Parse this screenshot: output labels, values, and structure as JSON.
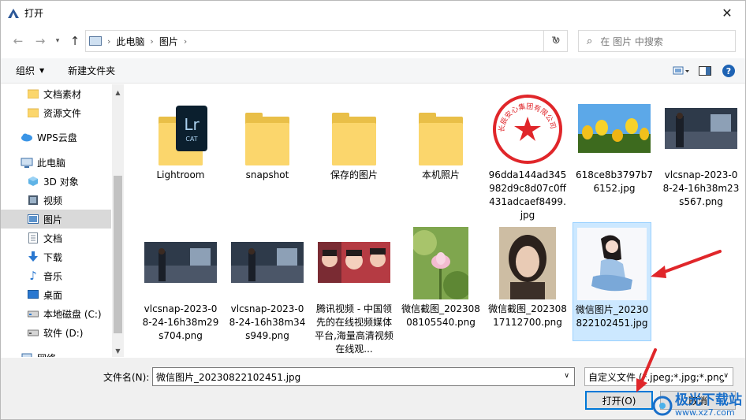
{
  "window": {
    "title": "打开"
  },
  "address": {
    "crumbs": [
      "此电脑",
      "图片"
    ]
  },
  "search": {
    "placeholder": "在 图片 中搜索"
  },
  "toolbar": {
    "organize": "组织",
    "new_folder": "新建文件夹"
  },
  "sidebar": {
    "items": [
      {
        "label": "文档素材",
        "icon": "folder-icon"
      },
      {
        "label": "资源文件",
        "icon": "folder-icon"
      },
      {
        "label": "WPS云盘",
        "icon": "cloud-icon"
      },
      {
        "label": "此电脑",
        "icon": "computer-icon"
      },
      {
        "label": "3D 对象",
        "icon": "cube-icon"
      },
      {
        "label": "视频",
        "icon": "video-icon"
      },
      {
        "label": "图片",
        "icon": "picture-icon",
        "selected": true
      },
      {
        "label": "文档",
        "icon": "document-icon"
      },
      {
        "label": "下载",
        "icon": "download-icon"
      },
      {
        "label": "音乐",
        "icon": "music-icon"
      },
      {
        "label": "桌面",
        "icon": "desktop-icon"
      },
      {
        "label": "本地磁盘 (C:)",
        "icon": "drive-icon"
      },
      {
        "label": "软件 (D:)",
        "icon": "drive-icon"
      },
      {
        "label": "网络",
        "icon": "network-icon"
      }
    ]
  },
  "files": [
    {
      "name": "Lightroom",
      "kind": "folder-lr"
    },
    {
      "name": "snapshot",
      "kind": "folder"
    },
    {
      "name": "保存的图片",
      "kind": "folder"
    },
    {
      "name": "本机照片",
      "kind": "folder"
    },
    {
      "name": "96dda144ad345982d9c8d07c0ff431adcaef8499.jpg",
      "kind": "stamp"
    },
    {
      "name": "618ce8b3797b76152.jpg",
      "kind": "tulips"
    },
    {
      "name": "vlcsnap-2023-08-24-16h38m23s567.png",
      "kind": "room"
    },
    {
      "name": "vlcsnap-2023-08-24-16h38m29s704.png",
      "kind": "room"
    },
    {
      "name": "vlcsnap-2023-08-24-16h38m34s949.png",
      "kind": "room"
    },
    {
      "name": "腾讯视频 - 中国领先的在线视频媒体平台,海量高清视频在线观...",
      "kind": "faces"
    },
    {
      "name": "微信截图_20230808105540.png",
      "kind": "lotus"
    },
    {
      "name": "微信截图_20230817112700.png",
      "kind": "portrait"
    },
    {
      "name": "微信图片_20230822102451.jpg",
      "kind": "drawing",
      "selected": true
    }
  ],
  "stamp_text": "长辰安心集团有限公司",
  "bottom": {
    "filename_label": "文件名(N):",
    "filename_value": "微信图片_20230822102451.jpg",
    "filter_value": "自定义文件 (*.jpeg;*.jpg;*.png",
    "open_label": "打开(O)",
    "cancel_label": "取消"
  },
  "watermark": {
    "brand": "极光下载站",
    "url": "www.xz7.com"
  },
  "colors": {
    "accent": "#0078d7",
    "selection": "#cce8ff",
    "arrow": "#e0262a"
  }
}
